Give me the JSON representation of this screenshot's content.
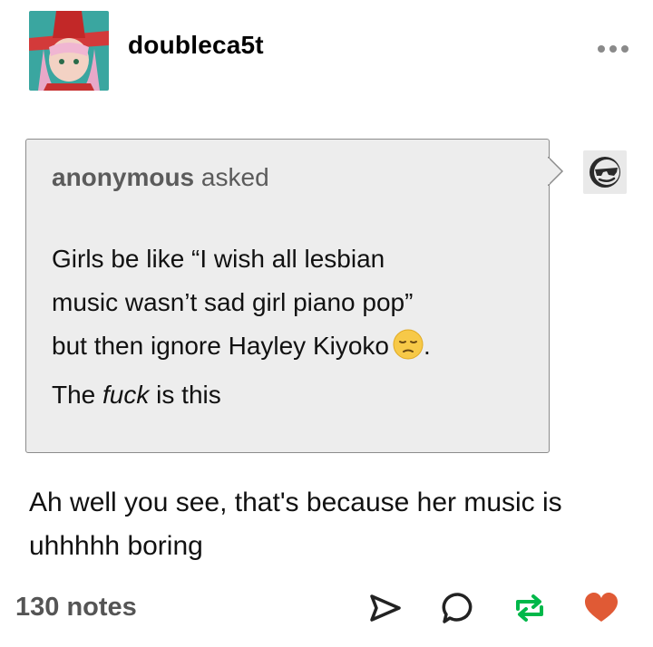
{
  "post": {
    "username": "doubleca5t",
    "more_icon": "more-horizontal-icon"
  },
  "ask": {
    "asker": "anonymous",
    "asked_word": "asked",
    "question_line1": "Girls be like “I wish all lesbian",
    "question_line2": "music wasn’t sad girl piano pop”",
    "question_line3_text": "but then ignore Hayley Kiyoko",
    "question_line3_end": ".",
    "question_line4_pre": "The ",
    "question_line4_em": "fuck",
    "question_line4_post": " is this",
    "emoji": "pensive-face-emoji",
    "asker_avatar_icon": "sunglasses-face-icon"
  },
  "answer": {
    "line1": "Ah well you see, that's because her music is",
    "line2": "uhhhhh boring"
  },
  "footer": {
    "notes": "130 notes",
    "share_icon": "share-icon",
    "reply_icon": "reply-icon",
    "reblog_icon": "reblog-icon",
    "like_icon": "heart-icon",
    "colors": {
      "reblog": "#00b84a",
      "like": "#e05a35",
      "icon": "#222222"
    }
  }
}
